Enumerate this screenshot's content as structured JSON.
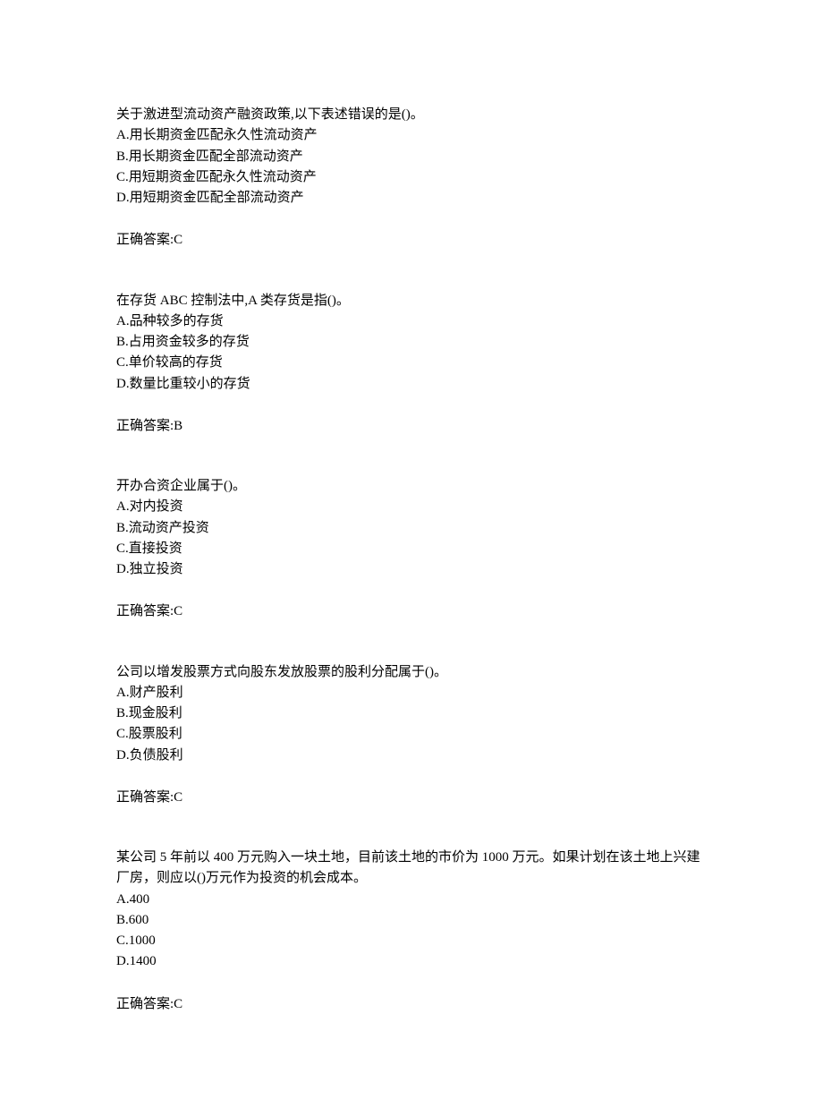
{
  "answer_label": "正确答案:",
  "questions": [
    {
      "stem": "关于激进型流动资产融资政策,以下表述错误的是()。",
      "options": [
        "A.用长期资金匹配永久性流动资产",
        "B.用长期资金匹配全部流动资产",
        "C.用短期资金匹配永久性流动资产",
        "D.用短期资金匹配全部流动资产"
      ],
      "answer": "C"
    },
    {
      "stem": "在存货 ABC 控制法中,A 类存货是指()。",
      "options": [
        "A.品种较多的存货",
        "B.占用资金较多的存货",
        "C.单价较高的存货",
        "D.数量比重较小的存货"
      ],
      "answer": "B"
    },
    {
      "stem": "开办合资企业属于()。",
      "options": [
        "A.对内投资",
        "B.流动资产投资",
        "C.直接投资",
        "D.独立投资"
      ],
      "answer": "C"
    },
    {
      "stem": "公司以增发股票方式向股东发放股票的股利分配属于()。",
      "options": [
        "A.财产股利",
        "B.现金股利",
        "C.股票股利",
        "D.负债股利"
      ],
      "answer": "C"
    },
    {
      "stem": "某公司 5 年前以 400 万元购入一块土地，目前该土地的市价为 1000 万元。如果计划在该土地上兴建厂房，则应以()万元作为投资的机会成本。",
      "options": [
        "A.400",
        "B.600",
        "C.1000",
        "D.1400"
      ],
      "answer": "C"
    }
  ]
}
